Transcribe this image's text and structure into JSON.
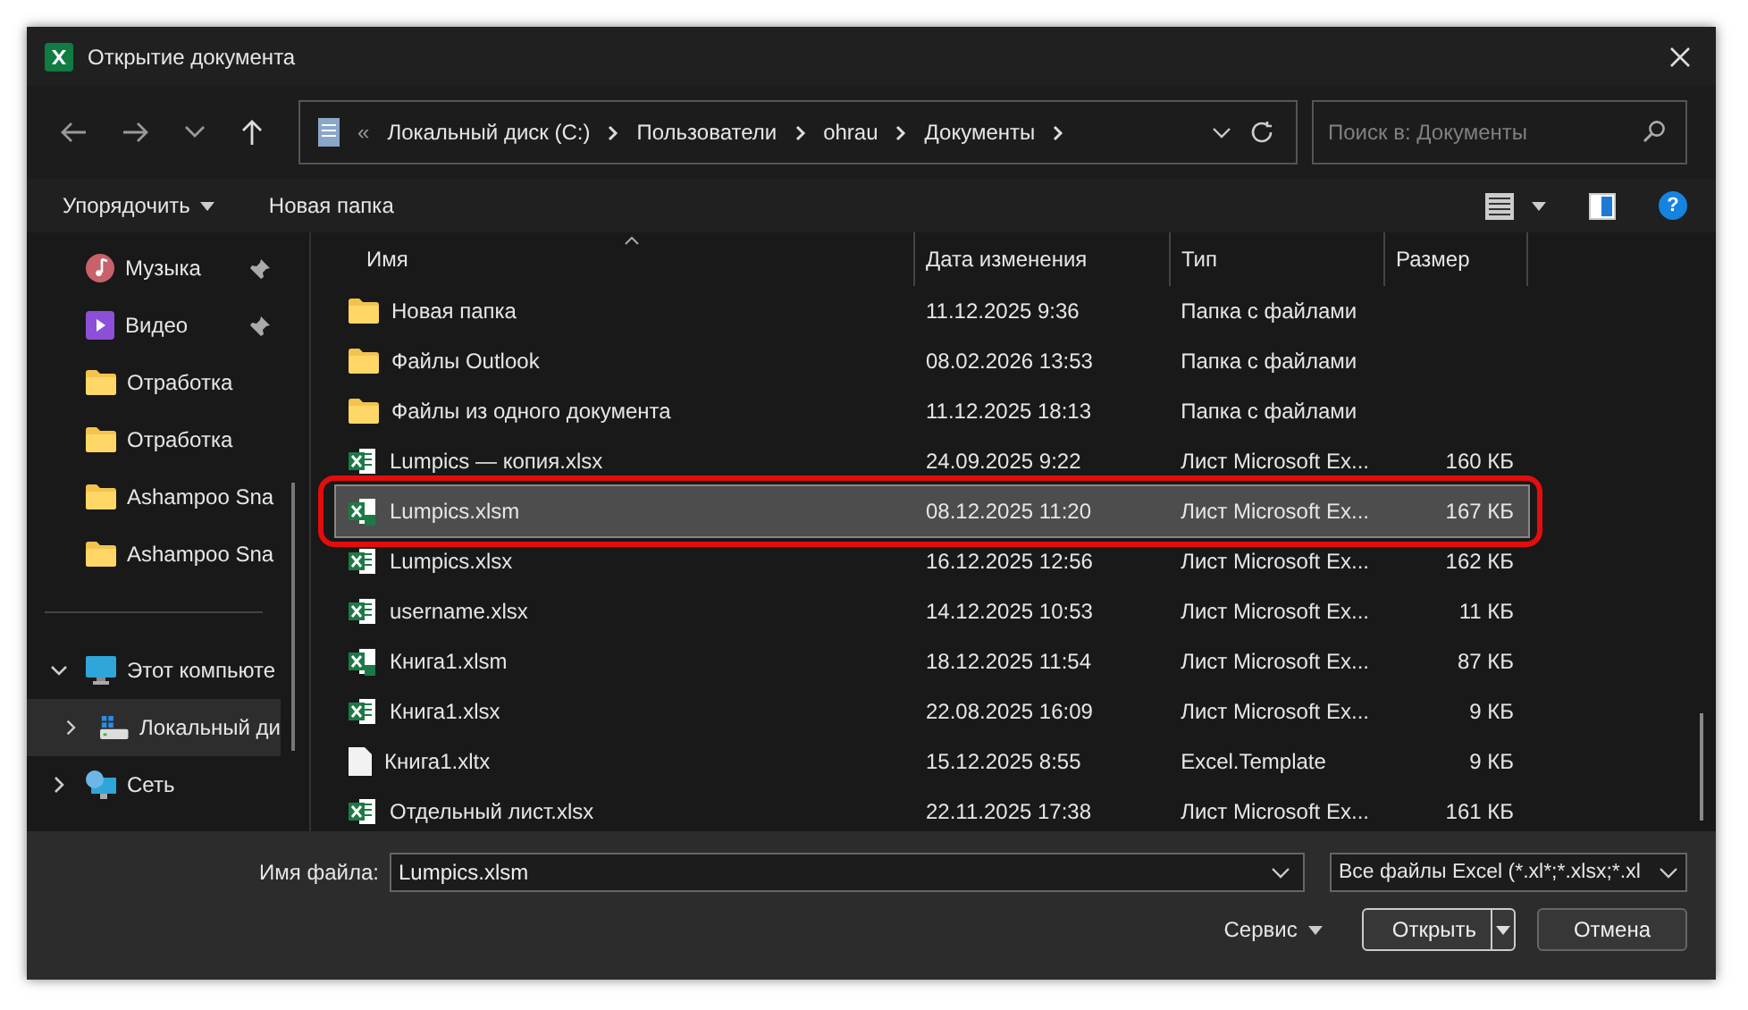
{
  "window": {
    "title": "Открытие документа"
  },
  "address_bar": {
    "overflow": "«",
    "segments": [
      "Локальный диск (C:)",
      "Пользователи",
      "ohrau",
      "Документы"
    ]
  },
  "search": {
    "placeholder": "Поиск в: Документы"
  },
  "command_bar": {
    "organize": "Упорядочить",
    "new_folder": "Новая папка",
    "help": "?"
  },
  "sidebar": {
    "items": [
      {
        "label": "Музыка",
        "kind": "music",
        "pinned": true,
        "selected": false
      },
      {
        "label": "Видео",
        "kind": "video",
        "pinned": true,
        "selected": false
      },
      {
        "label": "Отработка",
        "kind": "folder",
        "pinned": false,
        "selected": false
      },
      {
        "label": "Отработка",
        "kind": "folder",
        "pinned": false,
        "selected": false
      },
      {
        "label": "Ashampoo Sna",
        "kind": "folder",
        "pinned": false,
        "selected": false
      },
      {
        "label": "Ashampoo Sna",
        "kind": "folder",
        "pinned": false,
        "selected": false
      },
      {
        "label": "Этот компьюте",
        "kind": "pc",
        "expanded": true,
        "selected": false
      },
      {
        "label": "Локальный ди",
        "kind": "drive",
        "expanded": false,
        "selected": true
      },
      {
        "label": "Сеть",
        "kind": "network",
        "expanded": false,
        "selected": false
      }
    ]
  },
  "table": {
    "columns": [
      "Имя",
      "Дата изменения",
      "Тип",
      "Размер"
    ],
    "rows": [
      {
        "name": "Новая папка",
        "kind": "folder",
        "date": "11.12.2025 9:36",
        "type": "Папка с файлами",
        "selected": false
      },
      {
        "name": "Файлы Outlook",
        "kind": "folder",
        "date": "08.02.2026 13:53",
        "type": "Папка с файлами",
        "selected": false
      },
      {
        "name": "Файлы из одного документа",
        "kind": "folder",
        "date": "11.12.2025 18:13",
        "type": "Папка с файлами",
        "selected": false
      },
      {
        "name": "Lumpics — копия.xlsx",
        "kind": "xlsx",
        "date": "24.09.2025 9:22",
        "type": "Лист Microsoft Ex...",
        "size": "160 КБ",
        "selected": false
      },
      {
        "name": "Lumpics.xlsm",
        "kind": "xlsm",
        "date": "08.12.2025 11:20",
        "type": "Лист Microsoft Ex...",
        "size": "167 КБ",
        "selected": true
      },
      {
        "name": "Lumpics.xlsx",
        "kind": "xlsx",
        "date": "16.12.2025 12:56",
        "type": "Лист Microsoft Ex...",
        "size": "162 КБ",
        "selected": false
      },
      {
        "name": "username.xlsx",
        "kind": "xlsx",
        "date": "14.12.2025 10:53",
        "type": "Лист Microsoft Ex...",
        "size": "11 КБ",
        "selected": false
      },
      {
        "name": "Книга1.xlsm",
        "kind": "xlsm",
        "date": "18.12.2025 11:54",
        "type": "Лист Microsoft Ex...",
        "size": "87 КБ",
        "selected": false
      },
      {
        "name": "Книга1.xlsx",
        "kind": "xlsx",
        "date": "22.08.2025 16:09",
        "type": "Лист Microsoft Ex...",
        "size": "9 КБ",
        "selected": false
      },
      {
        "name": "Книга1.xltx",
        "kind": "xltx",
        "date": "15.12.2025 8:55",
        "type": "Excel.Template",
        "size": "9 КБ",
        "selected": false
      },
      {
        "name": "Отдельный лист.xlsx",
        "kind": "xlsx",
        "date": "22.11.2025 17:38",
        "type": "Лист Microsoft Ex...",
        "size": "161 КБ",
        "selected": false
      }
    ]
  },
  "footer": {
    "filename_label": "Имя файла:",
    "filename": "Lumpics.xlsm",
    "filter": "Все файлы Excel (*.xl*;*.xlsx;*.xl",
    "tools": "Сервис",
    "open": "Открыть",
    "cancel": "Отмена"
  }
}
